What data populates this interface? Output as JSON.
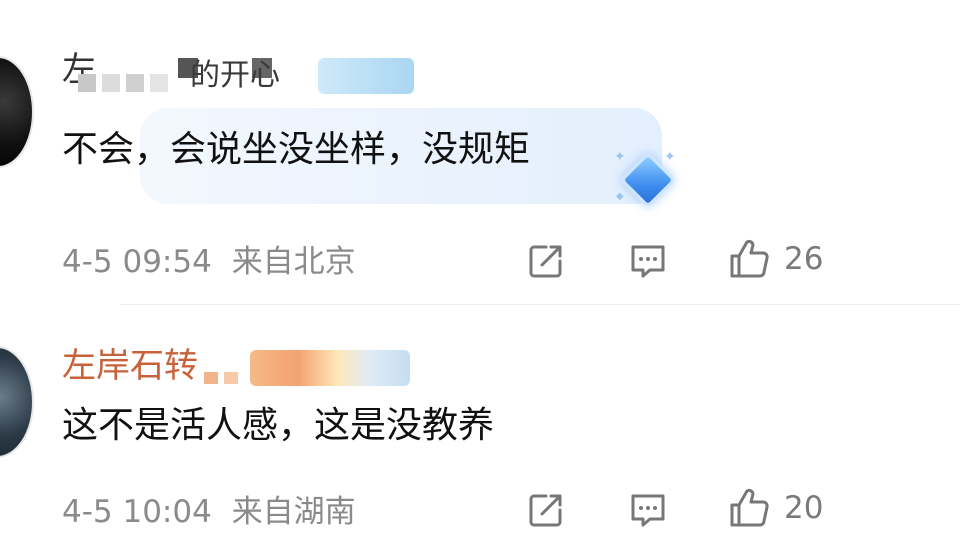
{
  "comments": [
    {
      "username": "左",
      "username_suffix": "的开心",
      "text": "不会，会说坐没坐样，没规矩",
      "time": "4-5 09:54",
      "location": "来自北京",
      "likes": "26",
      "icons": {
        "share": "share-icon",
        "comment": "comment-icon",
        "like": "thumbs-up-icon",
        "badge": "diamond-badge-icon"
      }
    },
    {
      "username": "左岸石转",
      "text": "这不是活人感，这是没教养",
      "time": "4-5 10:04",
      "location": "来自湖南",
      "likes": "20",
      "icons": {
        "share": "share-icon",
        "comment": "comment-icon",
        "like": "thumbs-up-icon"
      }
    }
  ],
  "colors": {
    "username_highlight": "#c7623a",
    "meta_text": "#8a8a8a",
    "body_text": "#111111",
    "bubble_bg": "#eaf2fd"
  }
}
